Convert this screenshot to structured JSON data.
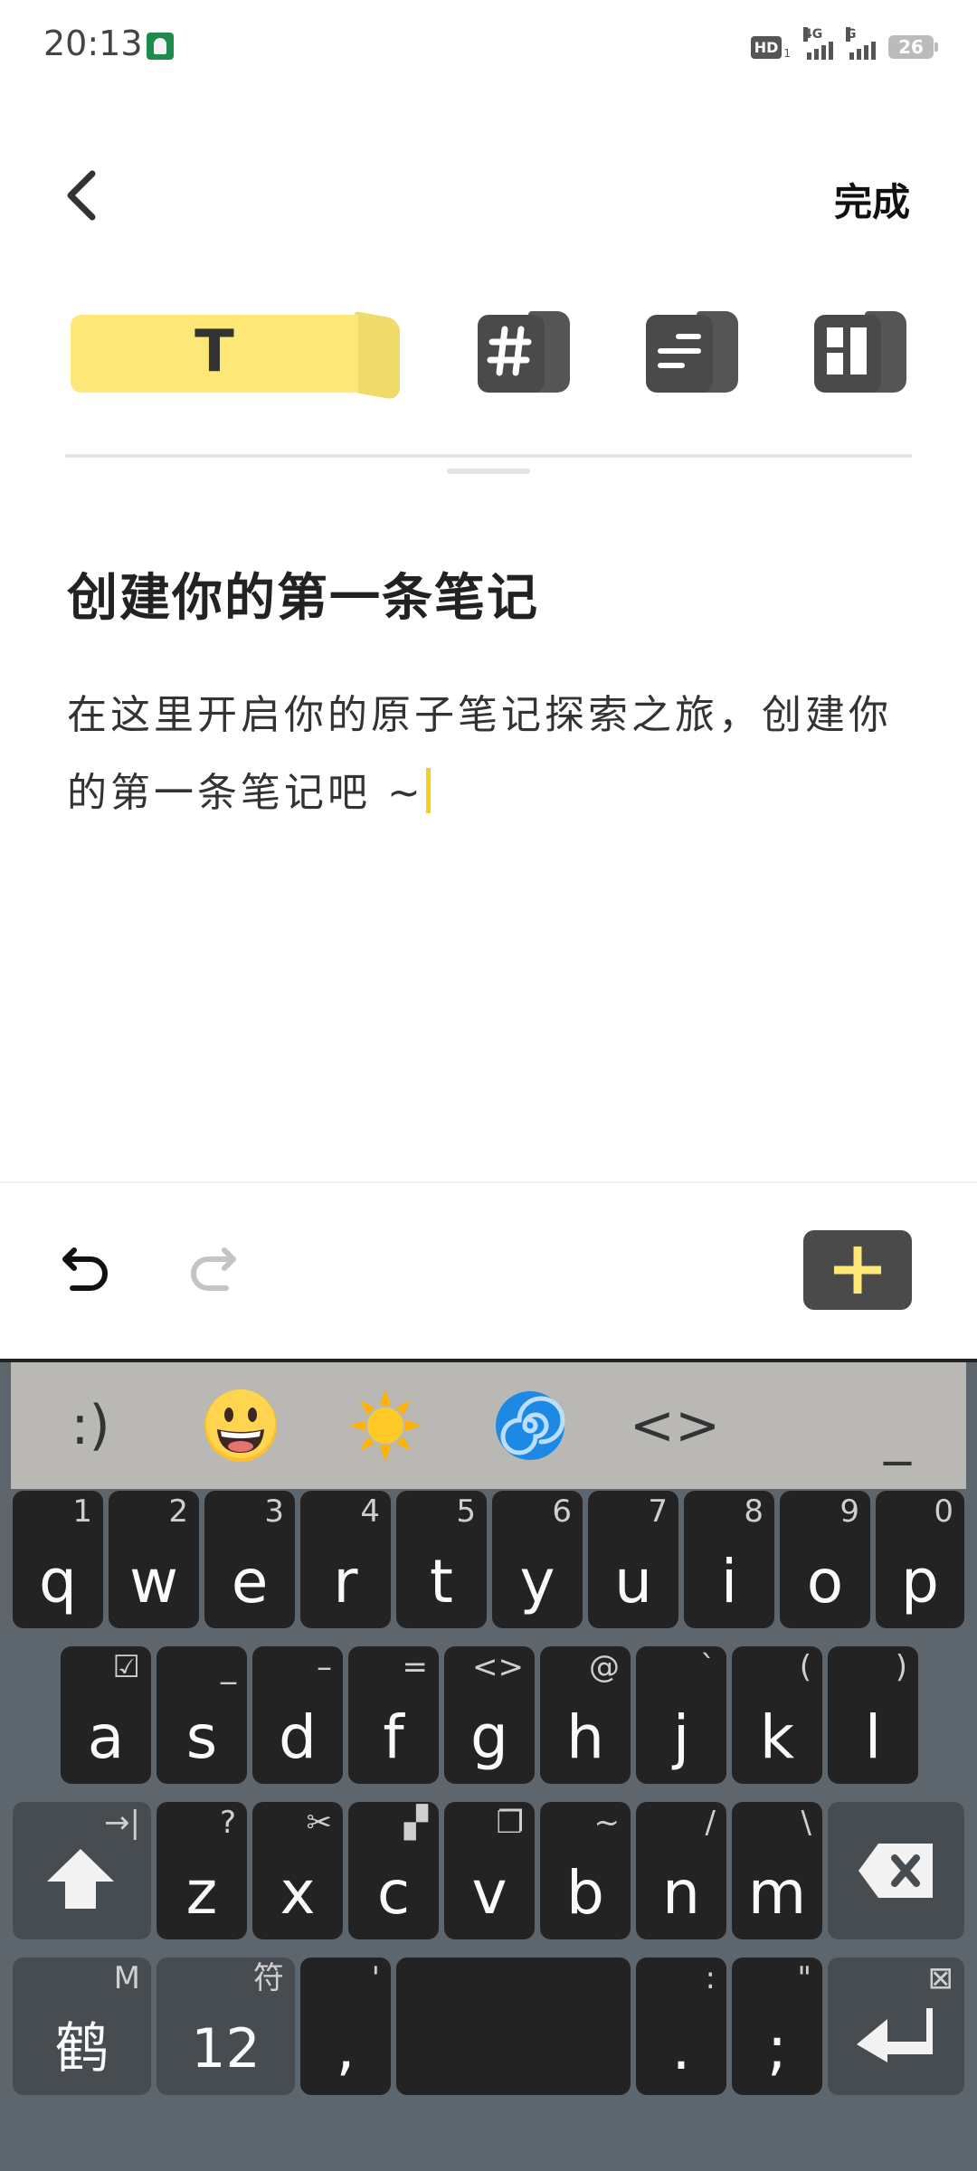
{
  "status_bar": {
    "time": "20:13",
    "hd_label": "HD",
    "hd_sub": "1",
    "network_1": "4G",
    "network_2": "G",
    "battery": "26"
  },
  "header": {
    "done_label": "完成"
  },
  "format_tabs": {
    "text_tab_glyph": "T",
    "selected": "text"
  },
  "note": {
    "title": "创建你的第一条笔记",
    "body": "在这里开启你的原子笔记探索之旅，创建你的第一条笔记吧 ~"
  },
  "keyboard": {
    "suggestions": [
      {
        "label": ":)",
        "kind": "text"
      },
      {
        "label": "😀",
        "kind": "emoji-grin"
      },
      {
        "label": "☀️",
        "kind": "emoji-sun"
      },
      {
        "label": "🌀",
        "kind": "emoji-cyclone"
      },
      {
        "label": "<>",
        "kind": "text"
      },
      {
        "label": "_",
        "kind": "text"
      }
    ],
    "row1": [
      {
        "main": "q",
        "sub": "1"
      },
      {
        "main": "w",
        "sub": "2"
      },
      {
        "main": "e",
        "sub": "3"
      },
      {
        "main": "r",
        "sub": "4"
      },
      {
        "main": "t",
        "sub": "5"
      },
      {
        "main": "y",
        "sub": "6"
      },
      {
        "main": "u",
        "sub": "7"
      },
      {
        "main": "i",
        "sub": "8"
      },
      {
        "main": "o",
        "sub": "9"
      },
      {
        "main": "p",
        "sub": "0"
      }
    ],
    "row2": [
      {
        "main": "a",
        "sub": "☑"
      },
      {
        "main": "s",
        "sub": "_"
      },
      {
        "main": "d",
        "sub": "–"
      },
      {
        "main": "f",
        "sub": "="
      },
      {
        "main": "g",
        "sub": "<>"
      },
      {
        "main": "h",
        "sub": "@"
      },
      {
        "main": "j",
        "sub": "`"
      },
      {
        "main": "k",
        "sub": "("
      },
      {
        "main": "l",
        "sub": ")"
      }
    ],
    "row3": [
      {
        "main": "z",
        "sub": "?"
      },
      {
        "main": "x",
        "sub": "✂"
      },
      {
        "main": "c",
        "sub": "▞"
      },
      {
        "main": "v",
        "sub": "❐"
      },
      {
        "main": "b",
        "sub": "~"
      },
      {
        "main": "n",
        "sub": "/"
      },
      {
        "main": "m",
        "sub": "\\"
      }
    ],
    "shift_sub": "→|",
    "lang_key": {
      "main": "鹤",
      "sub": "M"
    },
    "num_key": {
      "main": "12",
      "sub": "符"
    },
    "comma_key": {
      "main": ",",
      "sub": "'"
    },
    "period_key": {
      "main": ".",
      "sub": ":"
    },
    "semicolon_key": {
      "main": ";",
      "sub": "\""
    },
    "enter_sub": "⊠"
  },
  "colors": {
    "accent_yellow": "#fce777",
    "dark_button": "#4a4a4a",
    "keyboard_bg": "#5e666d",
    "key_bg": "#232323"
  }
}
